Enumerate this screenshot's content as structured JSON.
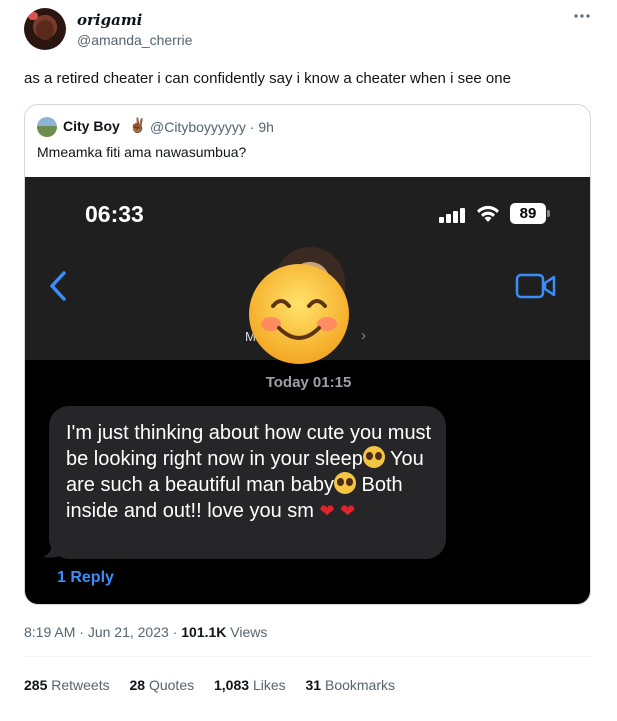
{
  "tweet": {
    "display_name": "origami",
    "handle": "@amanda_cherrie",
    "text": "as a retired cheater i can confidently say i know a cheater when i see one",
    "more_icon": "more-horizontal-icon"
  },
  "quote": {
    "display_name": "City Boy",
    "emoji": "✌🏾",
    "handle": "@Cityboyyyyyy",
    "separator": "·",
    "age": "9h",
    "text": "Mmeamka fiti ama nawasumbua?"
  },
  "phone": {
    "time": "06:33",
    "battery": "89",
    "contact_initial": "M",
    "date_stamp": "Today 01:15",
    "message_parts": [
      "I'm just thinking about how cute you must be looking right now in your sleep",
      " You are such a beautiful man baby",
      " Both inside and out!! love you sm"
    ],
    "reply_link": "1 Reply",
    "colors": {
      "bubble": "#262628",
      "link": "#3b8ef7",
      "header": "#1f1f1f"
    }
  },
  "meta": {
    "time": "8:19 AM",
    "date": "Jun 21, 2023",
    "separator": "·",
    "views_count": "101.1K",
    "views_label": "Views"
  },
  "stats": {
    "retweets_count": "285",
    "retweets_label": "Retweets",
    "quotes_count": "28",
    "quotes_label": "Quotes",
    "likes_count": "1,083",
    "likes_label": "Likes",
    "bookmarks_count": "31",
    "bookmarks_label": "Bookmarks"
  }
}
